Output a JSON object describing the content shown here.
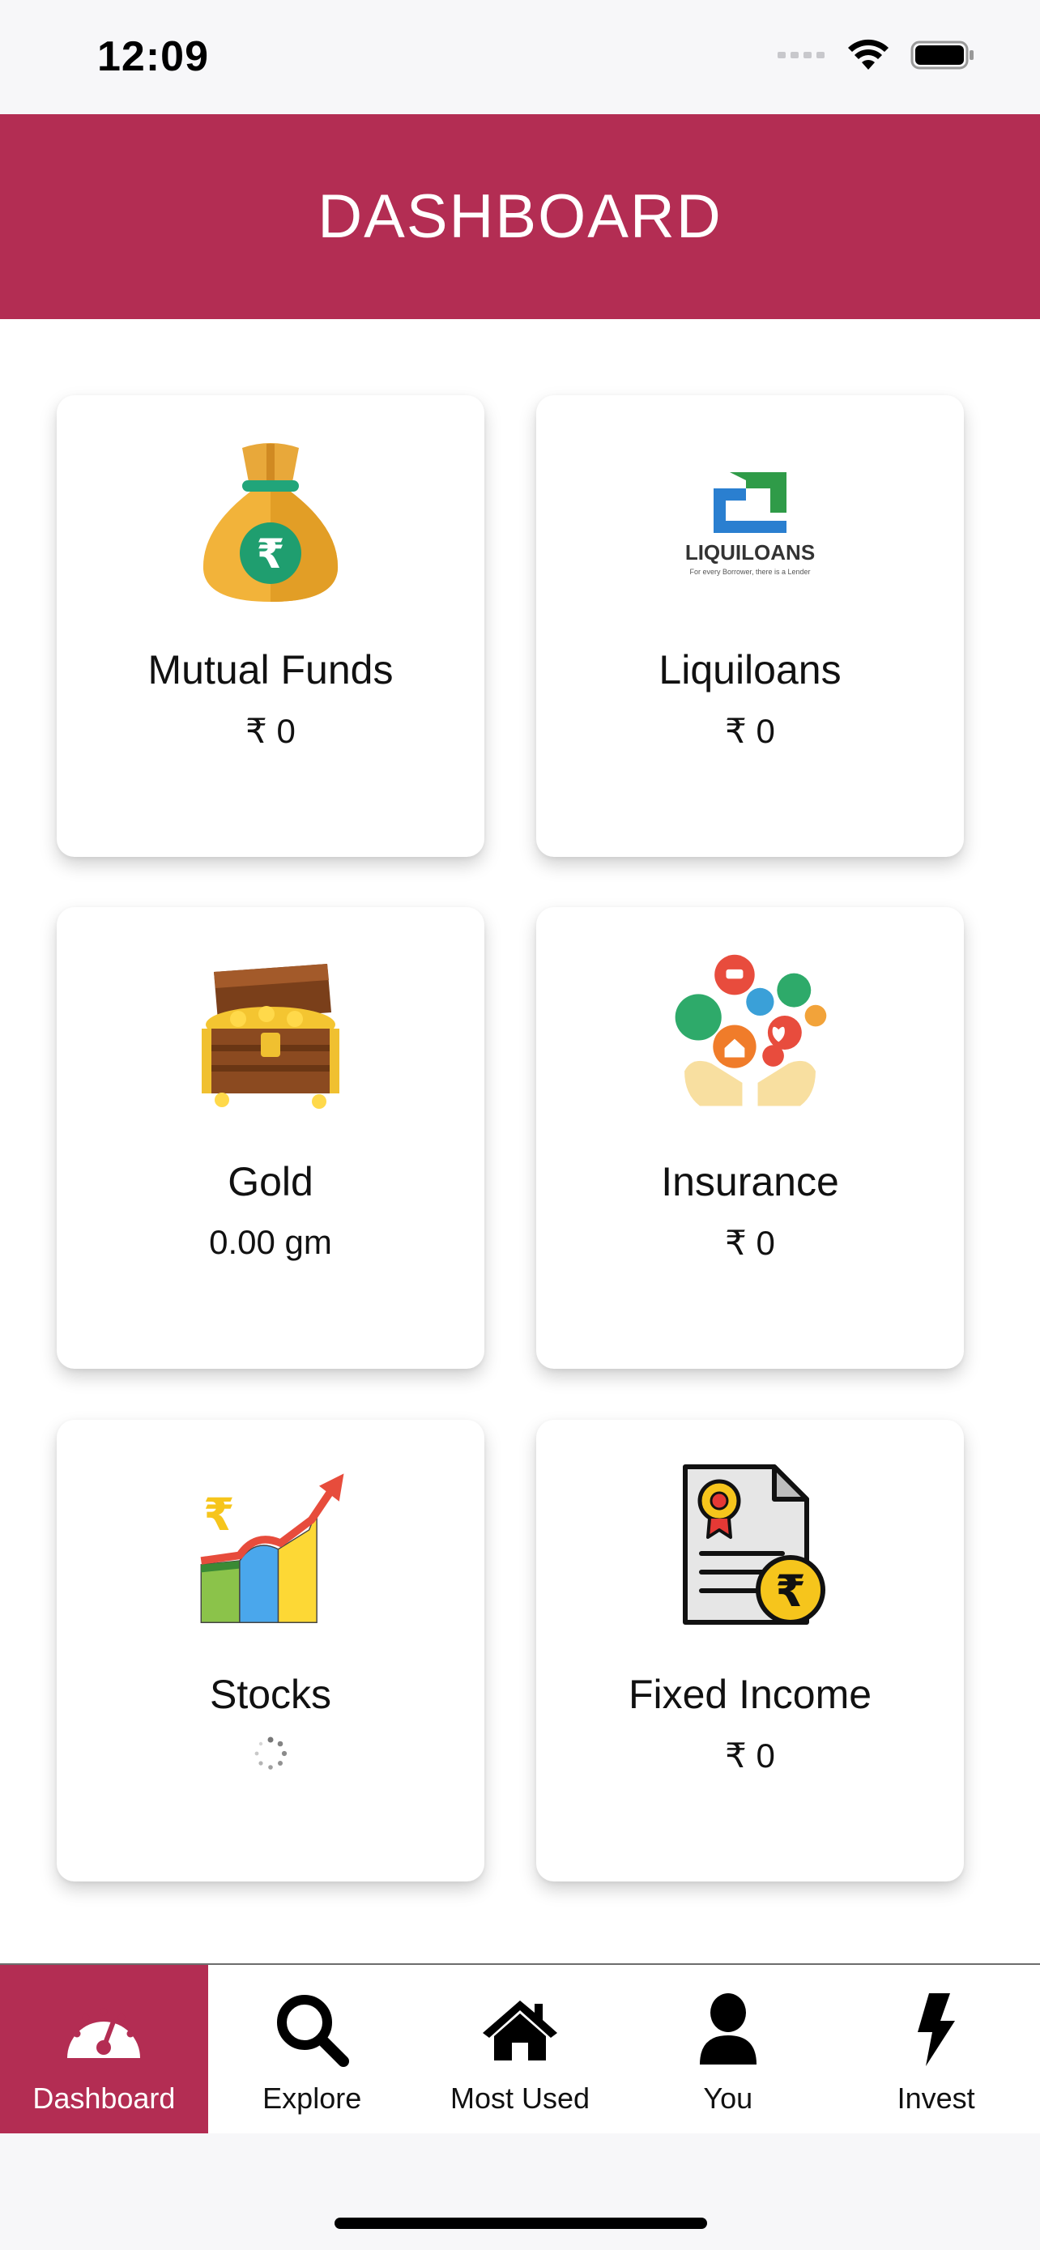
{
  "status_bar": {
    "time": "12:09",
    "icons": [
      "signal-icon",
      "wifi-icon",
      "battery-icon"
    ]
  },
  "header": {
    "title": "DASHBOARD"
  },
  "cards": [
    {
      "title": "Mutual Funds",
      "value": "₹ 0",
      "icon": "money-bag-icon"
    },
    {
      "title": "Liquiloans",
      "value": "₹ 0",
      "icon": "liquiloans-logo",
      "logo_text": "LIQUILOANS",
      "logo_tagline": "For every Borrower, there is a Lender"
    },
    {
      "title": "Gold",
      "value": "0.00 gm",
      "icon": "treasure-chest-icon"
    },
    {
      "title": "Insurance",
      "value": "₹ 0",
      "icon": "insurance-icon"
    },
    {
      "title": "Stocks",
      "value": "",
      "icon": "stocks-chart-icon",
      "loading": true
    },
    {
      "title": "Fixed Income",
      "value": "₹ 0",
      "icon": "certificate-rupee-icon"
    }
  ],
  "tabs": [
    {
      "label": "Dashboard",
      "icon": "speedometer-icon",
      "active": true
    },
    {
      "label": "Explore",
      "icon": "search-icon",
      "active": false
    },
    {
      "label": "Most Used",
      "icon": "home-icon",
      "active": false
    },
    {
      "label": "You",
      "icon": "user-icon",
      "active": false
    },
    {
      "label": "Invest",
      "icon": "bolt-icon",
      "active": false
    }
  ],
  "colors": {
    "accent": "#b32d53",
    "background": "#ffffff",
    "status_bar": "#f7f7f9"
  }
}
